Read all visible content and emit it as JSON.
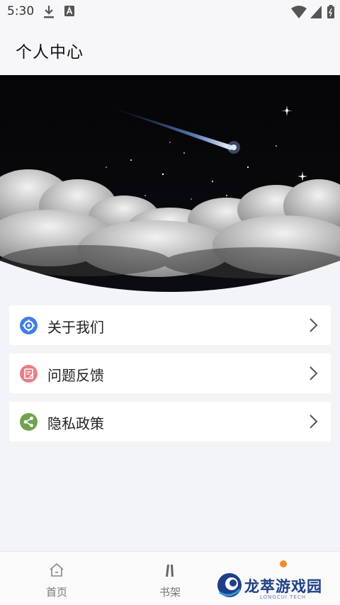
{
  "status_bar": {
    "time": "5:30",
    "icons": [
      "download-icon",
      "a-badge-icon",
      "wifi-icon",
      "signal-icon",
      "battery-icon"
    ]
  },
  "header": {
    "title": "个人中心"
  },
  "menu": {
    "items": [
      {
        "label": "关于我们",
        "icon": "gear-icon",
        "color": "#3f7ee8"
      },
      {
        "label": "问题反馈",
        "icon": "edit-note-icon",
        "color": "#e77f86"
      },
      {
        "label": "隐私政策",
        "icon": "share-icon",
        "color": "#6fa34d"
      }
    ]
  },
  "tabbar": {
    "tabs": [
      {
        "label": "首页",
        "icon": "home-icon"
      },
      {
        "label": "书架",
        "icon": "bookshelf-icon"
      },
      {
        "label": "",
        "icon": "profile-icon"
      }
    ]
  },
  "watermark": {
    "name": "龙萃游戏园",
    "sub": "LONGCUI TECH"
  }
}
